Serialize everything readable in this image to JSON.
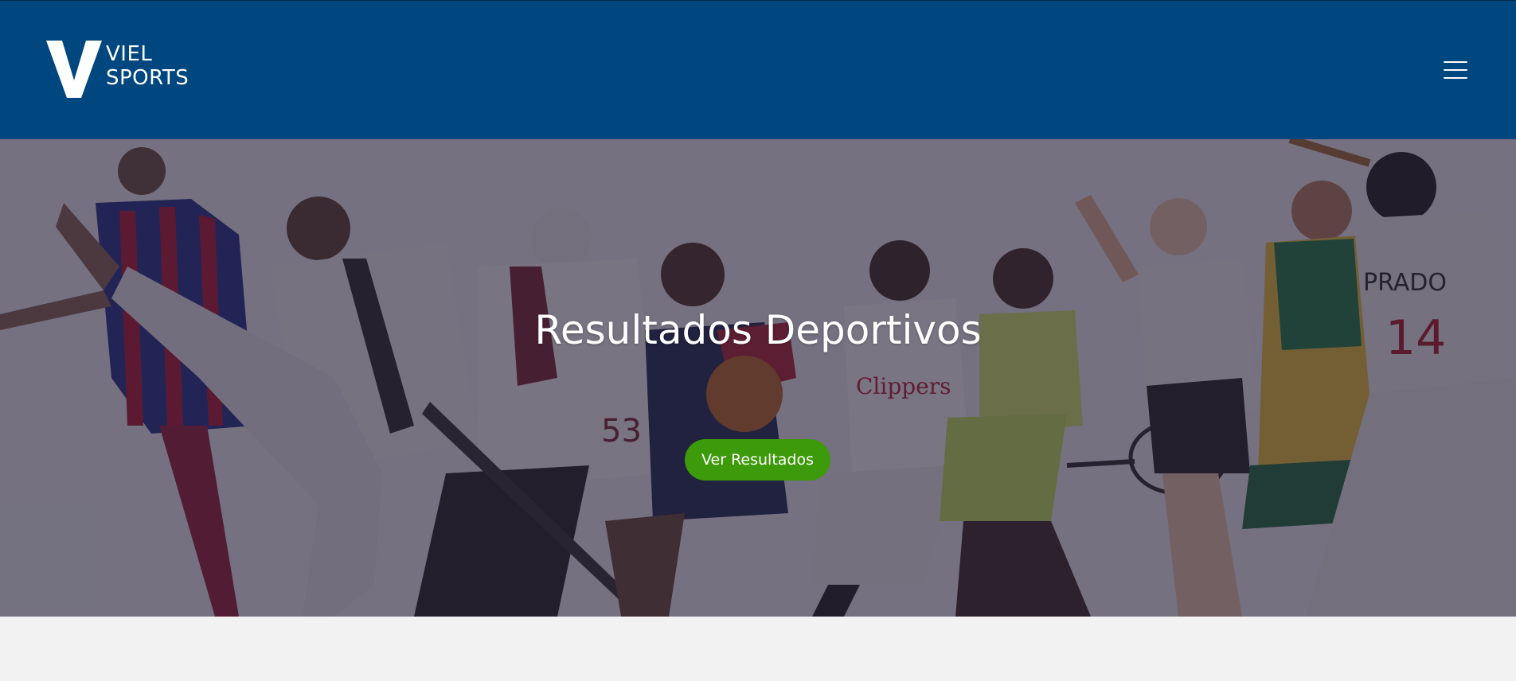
{
  "header": {
    "logo": {
      "mark_letter": "V",
      "line1": "VIEL",
      "line2": "SPORTS"
    },
    "menu_icon": "hamburger-menu-icon"
  },
  "hero": {
    "title": "Resultados Deportivos",
    "cta_label": "Ver Resultados",
    "image": "collage of athletes from various sports"
  },
  "colors": {
    "header_bg": "#00467f",
    "cta_bg": "#3d9a0a",
    "page_bg": "#f2f2f2"
  }
}
